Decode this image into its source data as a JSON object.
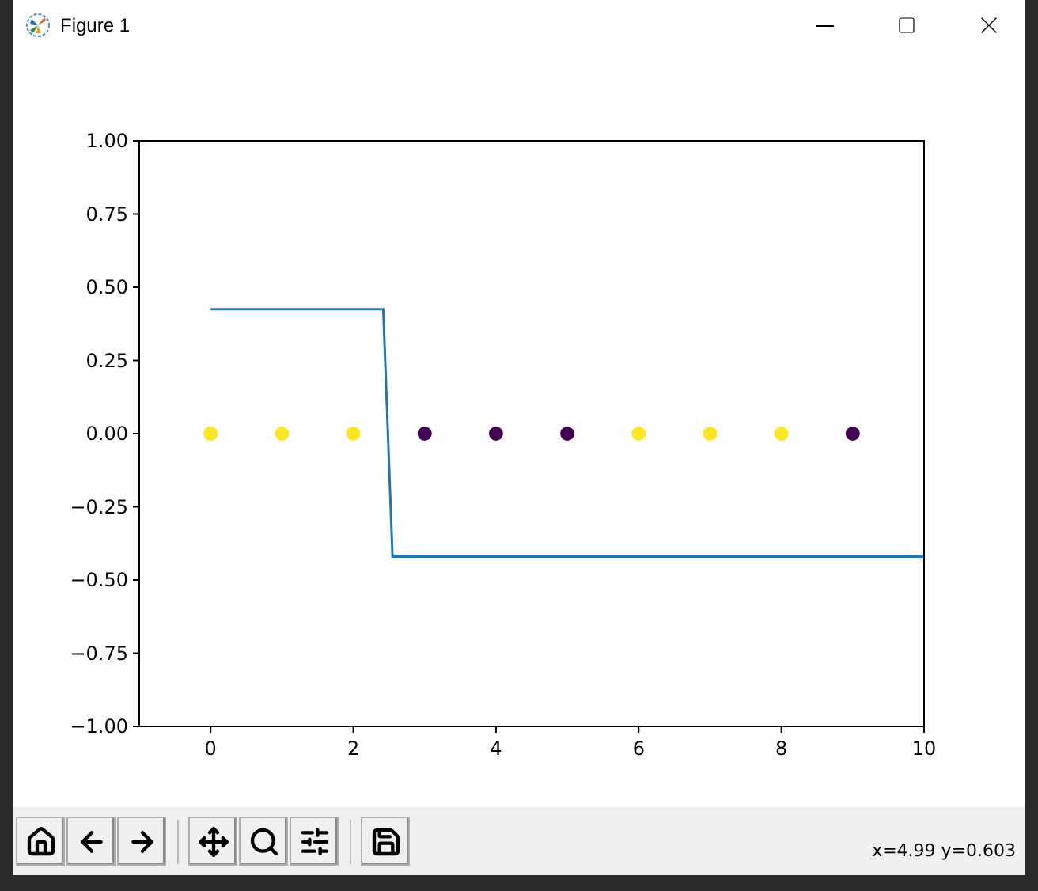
{
  "window": {
    "title": "Figure 1"
  },
  "figure": {
    "layers": [
      {
        "chart_data": {
          "type": "line",
          "xlim": [
            -1,
            10
          ],
          "ylim": [
            -1,
            1
          ],
          "xticks": [
            0,
            2,
            4,
            6,
            8,
            10
          ],
          "yticks": [
            {
              "value": 1,
              "label": "1.00"
            },
            {
              "value": 0.75,
              "label": "0.75"
            },
            {
              "value": 0.5,
              "label": "0.50"
            },
            {
              "value": 0.25,
              "label": "0.25"
            },
            {
              "value": 0,
              "label": "0.00"
            },
            {
              "value": -0.25,
              "label": "−0.25"
            },
            {
              "value": -0.5,
              "label": "−0.50"
            },
            {
              "value": -0.75,
              "label": "−0.75"
            },
            {
              "value": -1,
              "label": "−1.00"
            }
          ],
          "x": [
            0,
            2.42,
            2.55,
            10
          ],
          "series": [
            {
              "color": "#1f77b4",
              "values": [
                0.425,
                0.425,
                -0.42,
                -0.42
              ]
            }
          ]
        }
      },
      {
        "chart_data": {
          "type": "scatter",
          "xlim": [
            -1,
            10
          ],
          "ylim": [
            -1,
            1
          ],
          "series": [
            {
              "color": "#fde725",
              "x": [
                0,
                1,
                2,
                6,
                7,
                8
              ],
              "values": [
                0,
                0,
                0,
                0,
                0,
                0
              ]
            },
            {
              "color": "#440154",
              "x": [
                3,
                4,
                5,
                9
              ],
              "values": [
                0,
                0,
                0,
                0
              ]
            }
          ]
        }
      }
    ]
  },
  "toolbar": {
    "groups": [
      [
        {
          "kind": "home"
        },
        {
          "kind": "back"
        },
        {
          "kind": "forward"
        }
      ],
      [
        {
          "kind": "pan"
        },
        {
          "kind": "zoom"
        },
        {
          "kind": "configure"
        }
      ],
      [
        {
          "kind": "save"
        }
      ]
    ],
    "status": "x=4.99 y=0.603"
  }
}
